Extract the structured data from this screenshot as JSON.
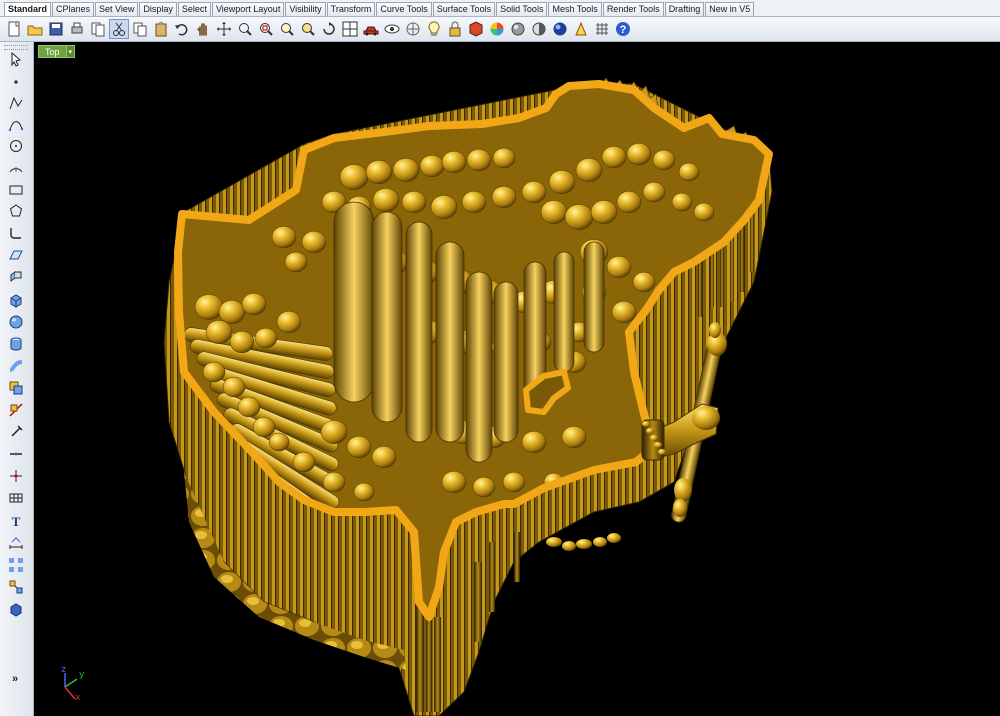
{
  "tabs": [
    {
      "label": "Standard",
      "active": true
    },
    {
      "label": "CPlanes"
    },
    {
      "label": "Set View"
    },
    {
      "label": "Display"
    },
    {
      "label": "Select"
    },
    {
      "label": "Viewport Layout"
    },
    {
      "label": "Visibility"
    },
    {
      "label": "Transform"
    },
    {
      "label": "Curve Tools"
    },
    {
      "label": "Surface Tools"
    },
    {
      "label": "Solid Tools"
    },
    {
      "label": "Mesh Tools"
    },
    {
      "label": "Render Tools"
    },
    {
      "label": "Drafting"
    },
    {
      "label": "New in V5"
    }
  ],
  "toolbar": {
    "icons": [
      "new-file-icon",
      "open-folder-icon",
      "save-icon",
      "print-icon",
      "copy-page-icon",
      "cut-icon",
      "copy-icon",
      "paste-icon",
      "undo-icon",
      "pan-hand-icon",
      "move-arrows-icon",
      "zoom-icon",
      "zoom-window-icon",
      "zoom-extents-icon",
      "zoom-selected-icon",
      "rotate-view-icon",
      "four-views-icon",
      "car-icon",
      "eye-icon",
      "cplane-icon",
      "bulb-icon",
      "lock-icon",
      "render-icon",
      "color-wheel-icon",
      "sphere-icon",
      "shade-icon",
      "globe-icon",
      "osnap-icon",
      "grid-icon",
      "help-icon"
    ]
  },
  "left_toolbar": {
    "icons": [
      "select-arrow-icon",
      "point-icon",
      "polyline-icon",
      "curve-icon",
      "circle-icon",
      "arc-icon",
      "rectangle-icon",
      "polygon-icon",
      "fillet-icon",
      "surface-icon",
      "extrude-icon",
      "box-icon",
      "sphere-icon",
      "cylinder-icon",
      "pipe-icon",
      "boolean-icon",
      "split-icon",
      "trim-icon",
      "join-icon",
      "explode-icon",
      "mesh-icon",
      "text-icon",
      "dimension-icon",
      "array-icon",
      "group-icon",
      "block-icon"
    ],
    "more_label": "»"
  },
  "viewport": {
    "title": "Top",
    "menu_glyph": "▾",
    "axes": {
      "x": "x",
      "y": "y",
      "z": "z"
    }
  },
  "colors": {
    "viewport_bg": "#000000",
    "outline": "#f2a816",
    "gold": "#d6a51e",
    "gold_dark": "#6e4f06",
    "gold_light": "#fde06a",
    "label_green": "#6fa33f"
  }
}
